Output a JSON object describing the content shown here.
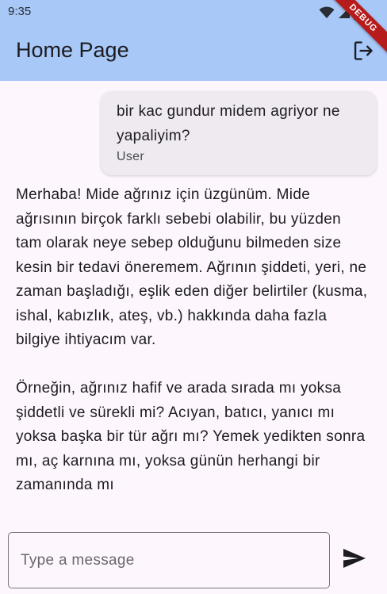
{
  "status_bar": {
    "time": "9:35",
    "icons": [
      "wifi-icon",
      "signal-icon",
      "battery-icon"
    ]
  },
  "debug_banner": "DEBUG",
  "app_bar": {
    "title": "Home Page",
    "action_icon": "logout-icon"
  },
  "messages": [
    {
      "role": "user",
      "text": "bir kac gundur midem agriyor ne yapaliyim?",
      "sender": "User"
    },
    {
      "role": "bot",
      "text": "Merhaba! Mide ağrınız için üzgünüm.  Mide ağrısının birçok farklı sebebi olabilir, bu yüzden tam olarak neye sebep olduğunu bilmeden size kesin bir tedavi öneremem.  Ağrının şiddeti, yeri, ne zaman başladığı, eşlik eden diğer belirtiler (kusma, ishal, kabızlık, ateş, vb.) hakkında daha fazla bilgiye ihtiyacım var.\n\nÖrneğin, ağrınız hafif ve arada sırada mı yoksa şiddetli ve sürekli mi?  Acıyan, batıcı, yanıcı mı yoksa başka bir tür ağrı mı?  Yemek yedikten sonra mı, aç karnına mı, yoksa günün herhangi bir zamanında mı"
    }
  ],
  "composer": {
    "placeholder": "Type a message",
    "value": "",
    "send_icon": "send-icon"
  },
  "colors": {
    "app_bar": "#a8c8f8",
    "background": "#fdf7fd",
    "user_bubble": "#efeaf0",
    "debug_ribbon": "#b71c1c"
  }
}
